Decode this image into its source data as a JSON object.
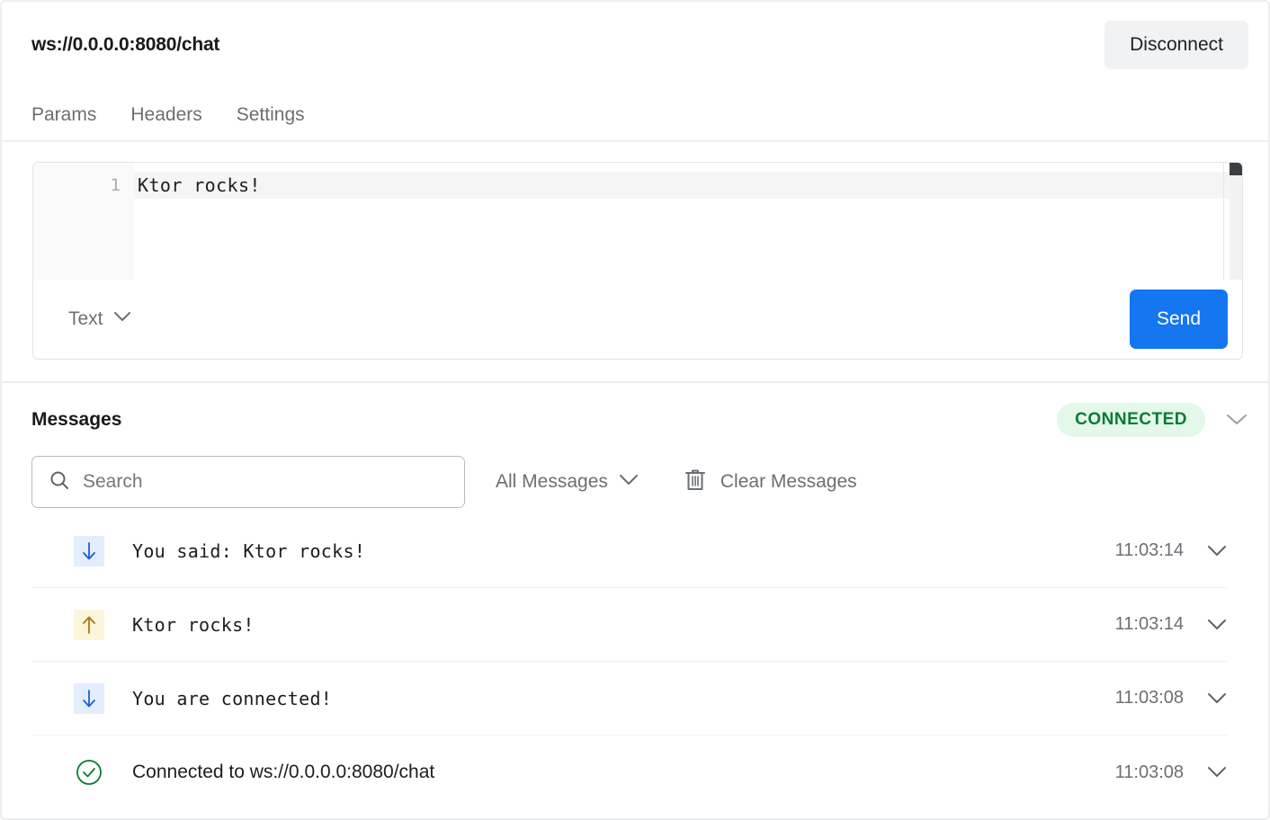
{
  "topbar": {
    "url": "ws://0.0.0.0:8080/chat",
    "disconnect_label": "Disconnect"
  },
  "tabs": [
    {
      "label": "Params"
    },
    {
      "label": "Headers"
    },
    {
      "label": "Settings"
    }
  ],
  "editor": {
    "line_number": "1",
    "content": "Ktor rocks!",
    "type_label": "Text",
    "send_label": "Send"
  },
  "messages_panel": {
    "title": "Messages",
    "status": "CONNECTED",
    "status_color": "#0a7b34",
    "status_bg": "#e3f8e9",
    "search_placeholder": "Search",
    "search_value": "",
    "filter_label": "All Messages",
    "clear_label": "Clear Messages"
  },
  "messages": [
    {
      "direction": "incoming",
      "icon": "arrow-down-icon",
      "text": "You said: Ktor rocks!",
      "time": "11:03:14",
      "mono": true
    },
    {
      "direction": "outgoing",
      "icon": "arrow-up-icon",
      "text": "Ktor rocks!",
      "time": "11:03:14",
      "mono": true
    },
    {
      "direction": "incoming",
      "icon": "arrow-down-icon",
      "text": "You are connected!",
      "time": "11:03:08",
      "mono": true
    },
    {
      "direction": "system",
      "icon": "check-circle-icon",
      "text": "Connected to ws://0.0.0.0:8080/chat",
      "time": "11:03:08",
      "mono": false
    }
  ],
  "colors": {
    "accent_blue": "#1576f2",
    "incoming_icon_bg": "#e3edfd",
    "incoming_icon_fg": "#1d5fd0",
    "outgoing_icon_bg": "#fdf5d9",
    "outgoing_icon_fg": "#a57a0c",
    "system_icon_fg": "#0a7b34"
  }
}
